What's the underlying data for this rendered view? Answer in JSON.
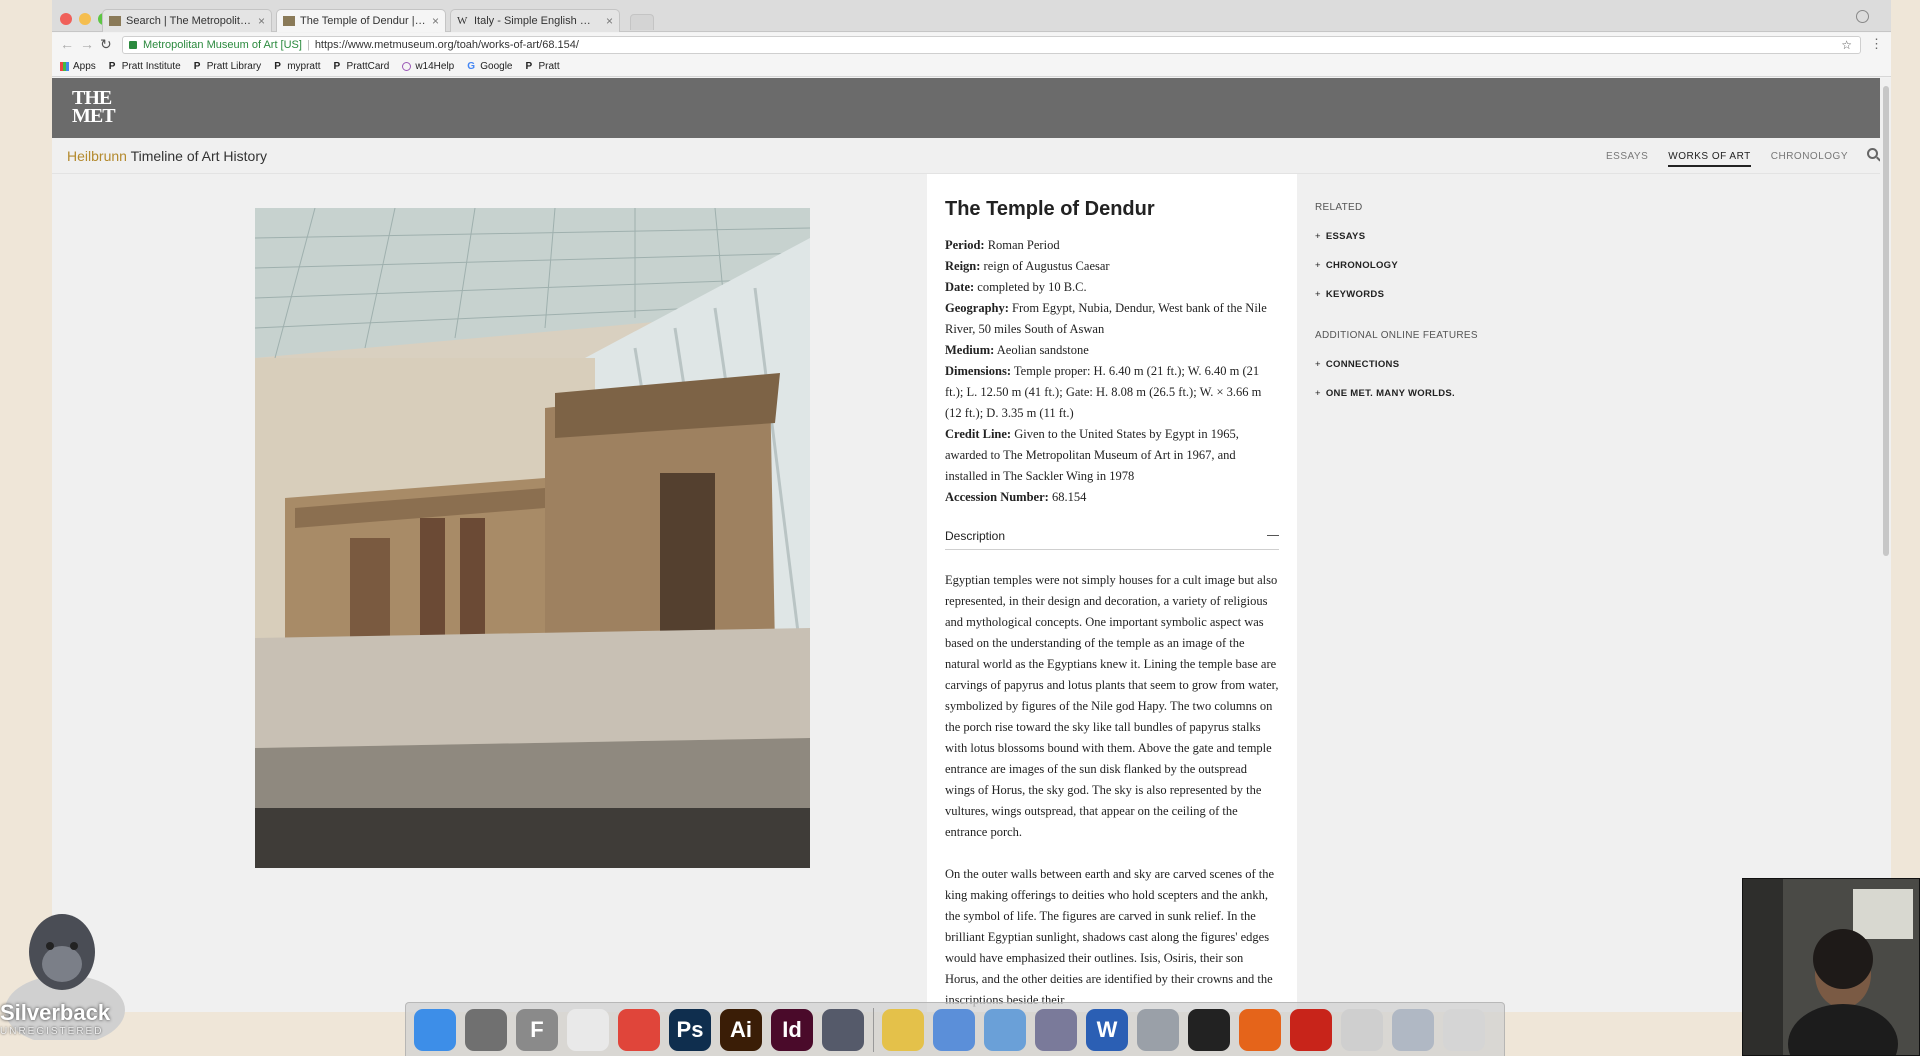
{
  "browser": {
    "tabs": [
      {
        "title": "Search | The Metropolitan Mu",
        "favicon": "met-favicon",
        "active": false
      },
      {
        "title": "The Temple of Dendur | Work",
        "favicon": "met-favicon",
        "active": true
      },
      {
        "title": "Italy - Simple English Wikiped",
        "favicon": "wikipedia-favicon",
        "active": false
      }
    ],
    "wiki_glyph": "W",
    "close_glyph": "×",
    "site_identity": "Metropolitan Museum of Art [US]",
    "url": "https://www.metmuseum.org/toah/works-of-art/68.154/",
    "bookmarks": [
      "Apps",
      "Pratt Institute",
      "Pratt Library",
      "mypratt",
      "PrattCard",
      "w14Help",
      "Google",
      "Pratt"
    ]
  },
  "header": {
    "logo_line1": "THE",
    "logo_line2": "MET"
  },
  "subnav": {
    "brand_highlight": "Heilbrunn",
    "brand_rest": "Timeline of Art History",
    "links": [
      "ESSAYS",
      "WORKS OF ART",
      "CHRONOLOGY"
    ],
    "active_link": "WORKS OF ART"
  },
  "artwork": {
    "title": "The Temple of Dendur",
    "fields": [
      {
        "label": "Period:",
        "value": "Roman Period"
      },
      {
        "label": "Reign:",
        "value": "reign of Augustus Caesar"
      },
      {
        "label": "Date:",
        "value": "completed by 10 B.C."
      },
      {
        "label": "Geography:",
        "value": "From Egypt, Nubia, Dendur, West bank of the Nile River, 50 miles South of Aswan"
      },
      {
        "label": "Medium:",
        "value": "Aeolian sandstone"
      },
      {
        "label": "Dimensions:",
        "value": "Temple proper: H. 6.40 m (21 ft.); W. 6.40 m (21 ft.); L. 12.50 m (41 ft.); Gate: H. 8.08 m (26.5 ft.); W. × 3.66 m (12 ft.); D. 3.35 m (11 ft.)"
      },
      {
        "label": "Credit Line:",
        "value": "Given to the United States by Egypt in 1965, awarded to The Metropolitan Museum of Art in 1967, and installed in The Sackler Wing in 1978"
      },
      {
        "label": "Accession Number:",
        "value": "68.154"
      }
    ],
    "description_heading": "Description",
    "description": [
      "Egyptian temples were not simply houses for a cult image but also represented, in their design and decoration, a variety of religious and mythological concepts. One important symbolic aspect was based on the understanding of the temple as an image of the natural world as the Egyptians knew it. Lining the temple base are carvings of papyrus and lotus plants that seem to grow from water, symbolized by figures of the Nile god Hapy. The two columns on the porch rise toward the sky like tall bundles of papyrus stalks with lotus blossoms bound with them. Above the gate and temple entrance are images of the sun disk flanked by the outspread wings of Horus, the sky god. The sky is also represented by the vultures, wings outspread, that appear on the ceiling of the entrance porch.",
      "On the outer walls between earth and sky are carved scenes of the king making offerings to deities who hold scepters and the ankh, the symbol of life. The figures are carved in sunk relief. In the brilliant Egyptian sunlight, shadows cast along the figures' edges would have emphasized their outlines. Isis, Osiris, their son Horus, and the other deities are identified by their crowns and the inscriptions beside their"
    ]
  },
  "related": {
    "heading": "RELATED",
    "items": [
      "ESSAYS",
      "CHRONOLOGY",
      "KEYWORDS"
    ],
    "heading2": "ADDITIONAL ONLINE FEATURES",
    "items2": [
      "CONNECTIONS",
      "ONE MET. MANY WORLDS."
    ],
    "plus": "+"
  },
  "dock": {
    "apps": [
      {
        "name": "finder-icon",
        "color": "#3d8ee8",
        "glyph": ""
      },
      {
        "name": "screenshot-icon",
        "color": "#707070",
        "glyph": ""
      },
      {
        "name": "fontbook-icon",
        "color": "#8a8a8a",
        "glyph": "F"
      },
      {
        "name": "textedit-icon",
        "color": "#e9e9e9",
        "glyph": ""
      },
      {
        "name": "chrome-icon",
        "color": "#e0453a",
        "glyph": ""
      },
      {
        "name": "photoshop-icon",
        "color": "#0f2e4e",
        "glyph": "Ps"
      },
      {
        "name": "illustrator-icon",
        "color": "#3a1d06",
        "glyph": "Ai"
      },
      {
        "name": "indesign-icon",
        "color": "#4a0a2a",
        "glyph": "Id"
      },
      {
        "name": "silverback-icon",
        "color": "#555a6a",
        "glyph": ""
      },
      {
        "name": "divider",
        "color": "",
        "glyph": ""
      },
      {
        "name": "stickies-icon",
        "color": "#e4c14a",
        "glyph": ""
      },
      {
        "name": "itunes-icon",
        "color": "#5b8fd9",
        "glyph": ""
      },
      {
        "name": "preview-icon",
        "color": "#6aa0d8",
        "glyph": ""
      },
      {
        "name": "iphoto-icon",
        "color": "#7a7a9a",
        "glyph": ""
      },
      {
        "name": "word-icon",
        "color": "#2b5fb4",
        "glyph": "W"
      },
      {
        "name": "ilife-icon",
        "color": "#9aa0a8",
        "glyph": ""
      },
      {
        "name": "agent-icon",
        "color": "#222222",
        "glyph": ""
      },
      {
        "name": "firefox-icon",
        "color": "#e5641a",
        "glyph": ""
      },
      {
        "name": "acrobat-icon",
        "color": "#c8241a",
        "glyph": ""
      },
      {
        "name": "downloads-icon",
        "color": "#cfcfcf",
        "glyph": ""
      },
      {
        "name": "documents-icon",
        "color": "#b0b8c4",
        "glyph": ""
      },
      {
        "name": "trash-icon",
        "color": "#d5d5d5",
        "glyph": ""
      }
    ]
  },
  "overlay": {
    "app_name": "Silverback",
    "app_status": "UNREGISTERED"
  }
}
